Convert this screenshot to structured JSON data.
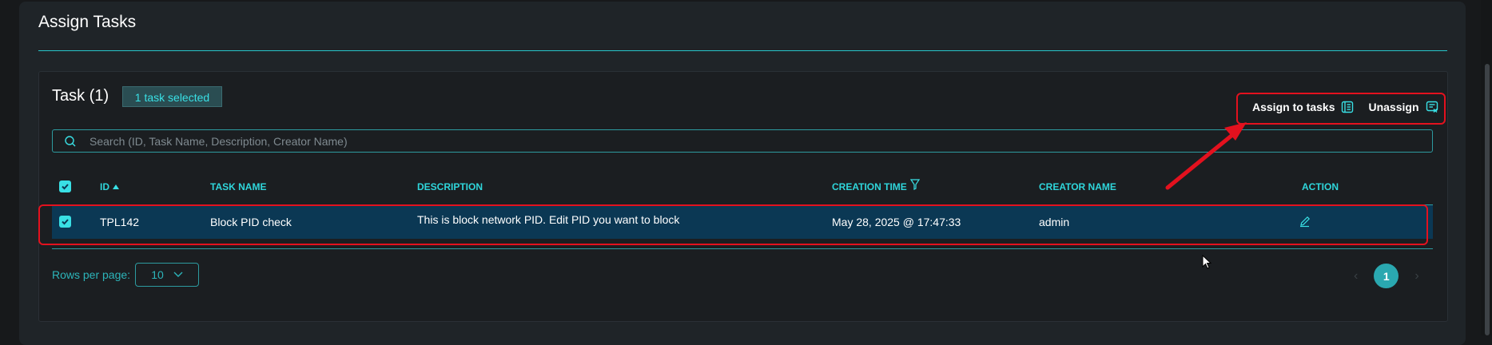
{
  "page": {
    "title": "Assign Tasks"
  },
  "tasks": {
    "heading": "Task (1)",
    "selected_badge": "1 task selected"
  },
  "toolbar": {
    "assign_label": "Assign to tasks",
    "unassign_label": "Unassign"
  },
  "search": {
    "placeholder": "Search (ID, Task Name, Description, Creator Name)"
  },
  "table": {
    "columns": [
      "ID",
      "TASK NAME",
      "DESCRIPTION",
      "CREATION TIME",
      "CREATOR NAME",
      "ACTION"
    ],
    "rows": [
      {
        "id": "TPL142",
        "task_name": "Block PID check",
        "description": "This is block network PID. Edit PID you want to block",
        "creation_time": "May 28, 2025 @ 17:47:33",
        "creator_name": "admin"
      }
    ]
  },
  "pagination": {
    "rows_per_page_label": "Rows per page:",
    "rows_per_page_value": "10",
    "current_page": "1"
  },
  "colors": {
    "accent": "#39e0e5",
    "selected_row": "#0b3854",
    "annotation": "#e3111e"
  },
  "icons": [
    "search-icon",
    "sort-ascending-icon",
    "filter-icon",
    "assign-list-icon",
    "unassign-list-icon",
    "edit-icon",
    "chevron-down-icon",
    "checkbox-checked-icon",
    "mouse-cursor-icon",
    "annotation-arrow"
  ]
}
